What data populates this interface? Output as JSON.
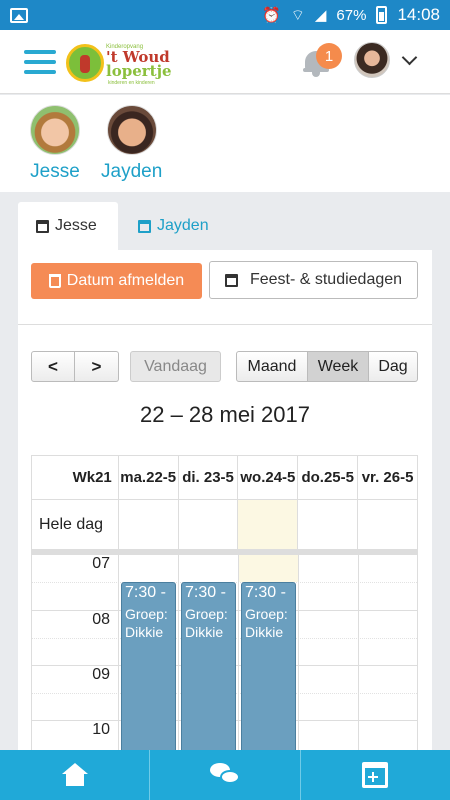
{
  "status_bar": {
    "battery": "67%",
    "time": "14:08"
  },
  "header": {
    "logo": {
      "small": "Kinderopvang",
      "name_line1": "'t Woud",
      "name_line2": "lopertje",
      "sub": "kinderen en kinderen"
    },
    "notification_count": "1"
  },
  "children": [
    {
      "name": "Jesse"
    },
    {
      "name": "Jayden"
    }
  ],
  "tabs": [
    {
      "label": "Jesse"
    },
    {
      "label": "Jayden"
    }
  ],
  "actions": {
    "afmelden": "Datum afmelden",
    "feest": "Feest- & studiedagen"
  },
  "calendar": {
    "prev": "<",
    "next": ">",
    "today": "Vandaag",
    "views": [
      "Maand",
      "Week",
      "Dag"
    ],
    "active_view": "Week",
    "range": "22 – 28 mei 2017",
    "week_label": "Wk21",
    "days": [
      {
        "line1": "ma.",
        "line2": "22-5"
      },
      {
        "line1": "di. 23-",
        "line2": "5"
      },
      {
        "line1": "wo.",
        "line2": "24-5"
      },
      {
        "line1": "do.",
        "line2": "25-5"
      },
      {
        "line1": "vr. 26-",
        "line2": "5"
      }
    ],
    "all_day_label": "Hele dag",
    "hours": [
      "07",
      "08",
      "09",
      "10"
    ],
    "events": [
      {
        "time": "7:30 -",
        "group": "Groep: Dikkie"
      },
      {
        "time": "7:30 -",
        "group": "Groep: Dikkie"
      },
      {
        "time": "7:30 -",
        "group": "Groep: Dikkie"
      }
    ]
  },
  "bottom_nav": [
    "home-icon",
    "chat-icon",
    "calendar-plus-icon"
  ]
}
